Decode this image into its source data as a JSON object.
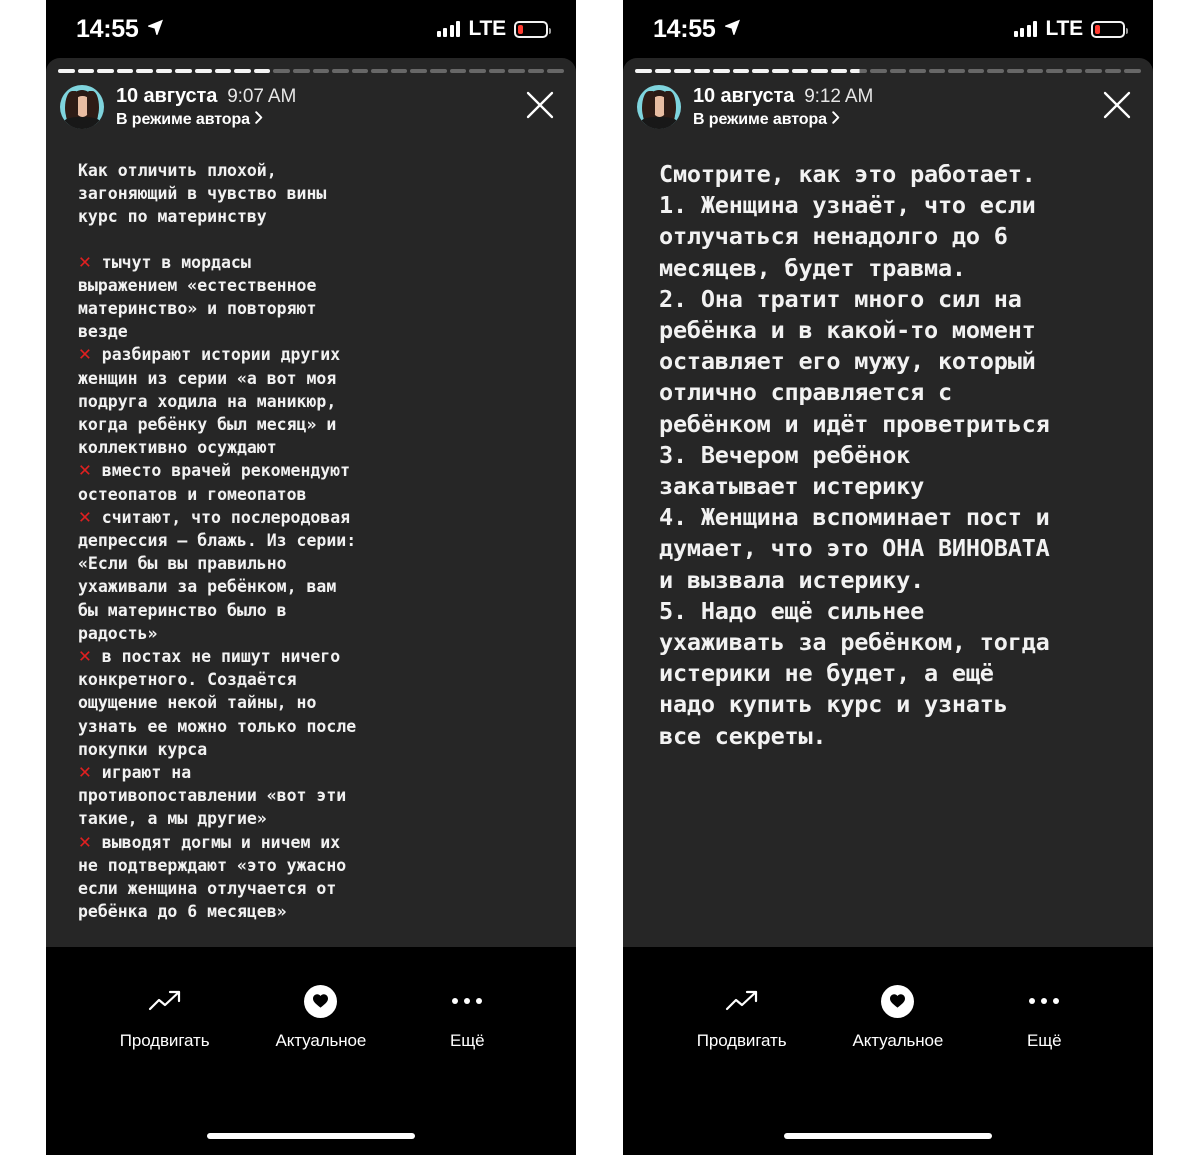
{
  "screens": [
    {
      "status_bar": {
        "time": "14:55",
        "location_icon": "location-arrow-icon",
        "signal_icon": "cellular-signal-icon",
        "carrier": "LTE",
        "battery_icon": "battery-low-icon",
        "battery_level_percent": 18
      },
      "progress": {
        "total": 26,
        "completed": 11,
        "partial_index": -1
      },
      "header": {
        "avatar": "user-avatar",
        "date": "10 августа",
        "time": "9:07 AM",
        "mode": "В режиме автора",
        "chevron_icon": "chevron-right-icon",
        "close_icon": "close-icon"
      },
      "story": {
        "size": "small",
        "blocks": [
          {
            "type": "paragraph",
            "text": "Как отличить плохой,\nзагоняющий в чувство вины\nкурс по материнству"
          },
          {
            "type": "spacer"
          },
          {
            "type": "bullet",
            "mark": "✕",
            "text": " тычут в мордасы\nвыражением «естественное\nматеринство» и повторяют\nвезде"
          },
          {
            "type": "bullet",
            "mark": "✕",
            "text": " разбирают истории других\nженщин из серии «а вот моя\nподруга ходила на маникюр,\nкогда ребёнку был месяц» и\nколлективно осуждают"
          },
          {
            "type": "bullet",
            "mark": "✕",
            "text": " вместо врачей рекомендуют\nостеопатов и гомеопатов"
          },
          {
            "type": "bullet",
            "mark": "✕",
            "text": " считают, что послеродовая\nдепрессия — блажь. Из серии:\n«Если бы вы правильно\nухаживали за ребёнком, вам\nбы материнство было в\nрадость»"
          },
          {
            "type": "bullet",
            "mark": "✕",
            "text": " в постах не пишут ничего\nконкретного. Создаётся\nощущение некой тайны, но\nузнать ее можно только после\nпокупки курса"
          },
          {
            "type": "bullet",
            "mark": "✕",
            "text": " играют на\nпротивопоставлении «вот эти\nтакие, а мы другие»"
          },
          {
            "type": "bullet",
            "mark": "✕",
            "text": " выводят догмы и ничем их\nне подтверждают «это ужасно\nесли женщина отлучается от\nребёнка до 6 месяцев»"
          }
        ]
      },
      "toolbar": {
        "items": [
          {
            "icon": "trending-up-icon",
            "label": "Продвигать"
          },
          {
            "icon": "heart-highlight-icon",
            "label": "Актуальное"
          },
          {
            "icon": "more-dots-icon",
            "label": "Ещё"
          }
        ],
        "home_indicator": "home-indicator"
      }
    },
    {
      "status_bar": {
        "time": "14:55",
        "location_icon": "location-arrow-icon",
        "signal_icon": "cellular-signal-icon",
        "carrier": "LTE",
        "battery_icon": "battery-low-icon",
        "battery_level_percent": 18
      },
      "progress": {
        "total": 26,
        "completed": 11,
        "partial_index": 11
      },
      "header": {
        "avatar": "user-avatar",
        "date": "10 августа",
        "time": "9:12 AM",
        "mode": "В режиме автора",
        "chevron_icon": "chevron-right-icon",
        "close_icon": "close-icon"
      },
      "story": {
        "size": "large",
        "blocks": [
          {
            "type": "paragraph",
            "text": "Смотрите, как это работает.\n1. Женщина узнаёт, что если\nотлучаться ненадолго до 6\nмесяцев, будет травма.\n2. Она тратит много сил на\nребёнка и в какой-то момент\nоставляет его мужу, который\nотлично справляется с\nребёнком и идёт проветриться\n3. Вечером ребёнок\nзакатывает истерику\n4. Женщина вспоминает пост и\nдумает, что это ОНА ВИНОВАТА\nи вызвала истерику.\n5. Надо ещё сильнее\nухаживать за ребёнком, тогда\nистерики не будет, а ещё\nнадо купить курс и узнать\nвсе секреты."
          }
        ]
      },
      "toolbar": {
        "items": [
          {
            "icon": "trending-up-icon",
            "label": "Продвигать"
          },
          {
            "icon": "heart-highlight-icon",
            "label": "Актуальное"
          },
          {
            "icon": "more-dots-icon",
            "label": "Ещё"
          }
        ],
        "home_indicator": "home-indicator"
      }
    }
  ],
  "colors": {
    "page_background": "#ffffff",
    "phone_background": "#000000",
    "story_background": "#262626",
    "text": "#f2f2f2",
    "accent_red": "#e02020",
    "battery_red": "#ff3b30",
    "avatar_ring": "#7fd4dd"
  }
}
